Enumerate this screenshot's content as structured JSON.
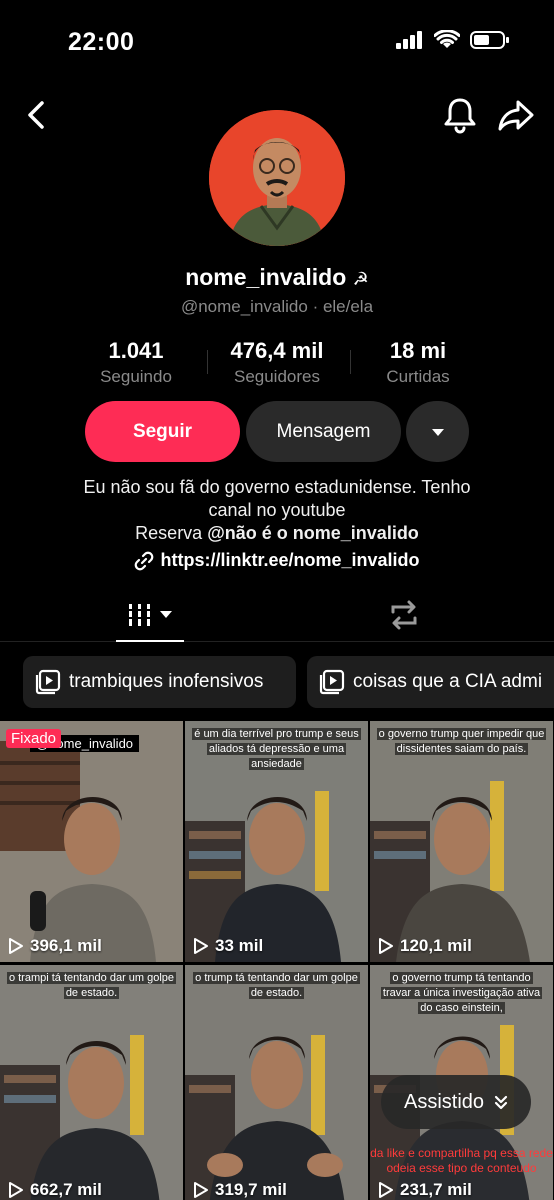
{
  "status_bar": {
    "time": "22:00"
  },
  "profile": {
    "username": "nome_invalido",
    "username_emoji": "☭",
    "handle": "@nome_invalido",
    "pronouns": "· ele/ela"
  },
  "stats": [
    {
      "value": "1.041",
      "label": "Seguindo"
    },
    {
      "value": "476,4 mil",
      "label": "Seguidores"
    },
    {
      "value": "18 mi",
      "label": "Curtidas"
    }
  ],
  "actions": {
    "follow": "Seguir",
    "message": "Mensagem"
  },
  "bio": {
    "line1": "Eu não sou fã do governo estadunidense. Tenho",
    "line2": "canal no youtube",
    "reserve_prefix": "Reserva",
    "reserve_handle": "@não é o nome_invalido",
    "link": "https://linktr.ee/nome_invalido"
  },
  "playlists": [
    {
      "label": "trambiques inofensivos"
    },
    {
      "label": "coisas que a CIA admi"
    }
  ],
  "videos": [
    {
      "views": "396,1 mil",
      "caption": "",
      "pinned_label": "Fixado",
      "watermark": "@nome_invalido"
    },
    {
      "views": "33 mil",
      "caption": "é um dia terrível pro trump e seus aliados tá depressão e uma ansiedade"
    },
    {
      "views": "120,1 mil",
      "caption": "o governo trump quer impedir que dissidentes saiam do país."
    },
    {
      "views": "662,7 mil",
      "caption": "o trampi tá tentando dar um golpe de estado."
    },
    {
      "views": "319,7 mil",
      "caption": "o trump tá tentando dar um golpe de estado."
    },
    {
      "views": "231,7 mil",
      "caption": "o governo trump tá tentando travar a única investigação ativa do caso einstein,",
      "bottom_caption": "da like e compartilha pq essa rede odeia esse tipo de conteudo"
    }
  ],
  "watched_button": {
    "label": "Assistido"
  },
  "colors": {
    "accent": "#fe2c55",
    "avatar_bg": "#e8452b",
    "button_dark": "#2a2a2a"
  }
}
